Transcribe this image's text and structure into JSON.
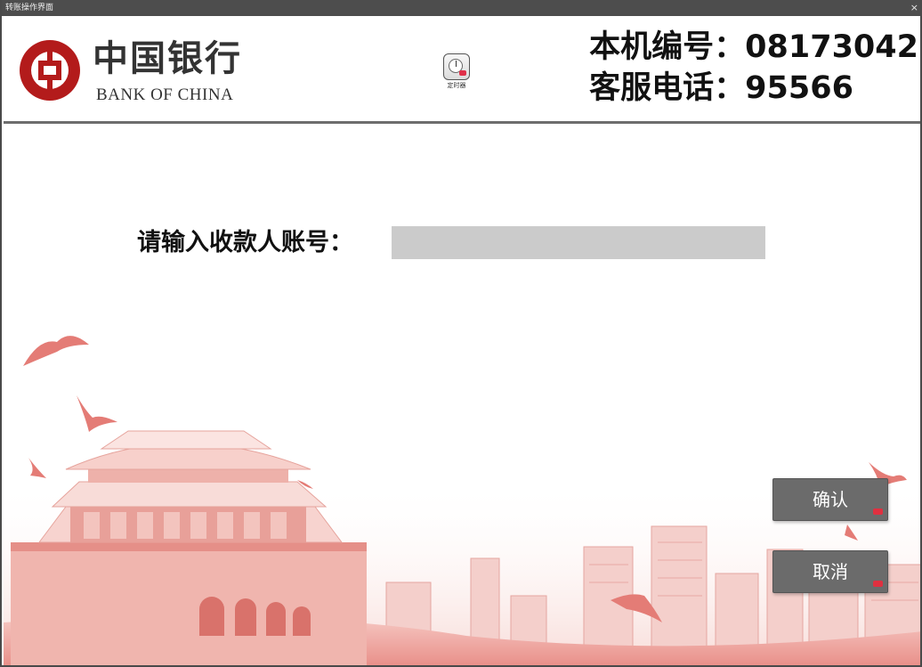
{
  "window": {
    "title": "转账操作界面",
    "close_glyph": "×"
  },
  "header": {
    "logo": {
      "cn": "中国银行",
      "en": "BANK OF CHINA"
    },
    "timer_label": "定时器",
    "machine_id_line": "本机编号：08173042",
    "hotline_line": "客服电话：95566"
  },
  "main": {
    "prompt": "请输入收款人账号：",
    "account_input": {
      "value": "",
      "placeholder": ""
    },
    "buttons": {
      "confirm": "确认",
      "cancel": "取消"
    }
  },
  "icons": [
    "close-icon",
    "bank-of-china-logo-icon",
    "timer-icon",
    "key-icon"
  ],
  "colors": {
    "brand_red": "#b31b1b",
    "button_gray": "#6b6b6b",
    "input_gray": "#cbcbcb",
    "titlebar": "#4d4d4d"
  }
}
